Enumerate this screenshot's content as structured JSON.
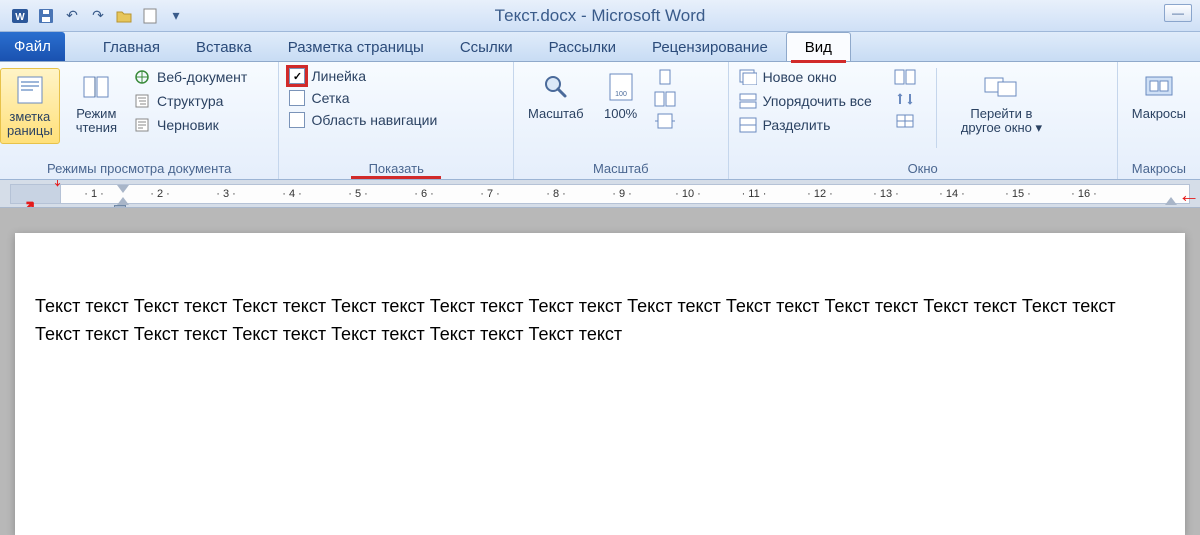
{
  "title": "Текст.docx - Microsoft Word",
  "tabs": {
    "file": "Файл",
    "home": "Главная",
    "insert": "Вставка",
    "pagelayout": "Разметка страницы",
    "references": "Ссылки",
    "mailings": "Рассылки",
    "review": "Рецензирование",
    "view": "Вид"
  },
  "groups": {
    "views": {
      "label": "Режимы просмотра документа",
      "printlayout": "зметка\nраницы",
      "reading": "Режим\nчтения",
      "web": "Веб-документ",
      "outline": "Структура",
      "draft": "Черновик"
    },
    "show": {
      "label": "Показать",
      "ruler": "Линейка",
      "grid": "Сетка",
      "navpane": "Область навигации"
    },
    "zoom": {
      "label": "Масштаб",
      "zoombtn": "Масштаб",
      "hundred": "100%"
    },
    "window": {
      "label": "Окно",
      "newwin": "Новое окно",
      "arrange": "Упорядочить все",
      "split": "Разделить",
      "switch": "Перейти в\nдругое окно"
    },
    "macros": {
      "label": "Макросы",
      "macros": "Макросы"
    }
  },
  "ruler_numbers": [
    "1",
    "2",
    "3",
    "4",
    "5",
    "6",
    "7",
    "8",
    "9",
    "10",
    "11",
    "12",
    "13",
    "14",
    "15",
    "16"
  ],
  "document": {
    "para1": "Текст текст Текст текст Текст текст Текст текст Текст текст Текст текст Текст текст Текст текст Текст текст Текст текст Текст текст Текст текст Текст текст Текст текст Текст текст Текст текст Текст текст"
  }
}
